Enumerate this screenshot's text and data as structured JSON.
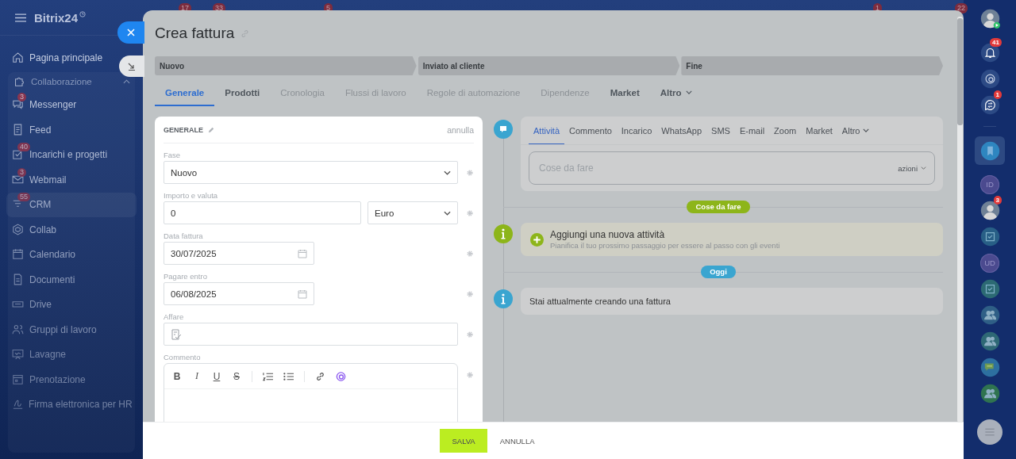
{
  "top_badges": [
    "17",
    "33",
    "5",
    "1",
    "22"
  ],
  "sidebar": {
    "brand": "Bitrix24",
    "items": [
      {
        "label": "Pagina principale",
        "selected": false
      },
      {
        "label": "Collaborazione",
        "expanded": true,
        "children": [
          {
            "label": "Messenger",
            "badge": "3",
            "selected": false
          },
          {
            "label": "Feed",
            "selected": false
          },
          {
            "label": "Incarichi e progetti",
            "badge": "40",
            "selected": false
          },
          {
            "label": "Webmail",
            "badge": "3",
            "selected": false
          },
          {
            "label": "CRM",
            "badge": "55",
            "selected": true
          },
          {
            "label": "Collab",
            "selected": false
          },
          {
            "label": "Calendario",
            "selected": false
          },
          {
            "label": "Documenti",
            "selected": false
          },
          {
            "label": "Drive",
            "selected": false
          },
          {
            "label": "Gruppi di lavoro",
            "selected": false
          },
          {
            "label": "Lavagne",
            "selected": false
          },
          {
            "label": "Prenotazione",
            "selected": false
          },
          {
            "label": "Firma elettronica per HR",
            "selected": false
          }
        ]
      }
    ]
  },
  "panel": {
    "title": "Crea fattura",
    "stages": [
      {
        "label": "Nuovo"
      },
      {
        "label": "Inviato al cliente"
      },
      {
        "label": "Fine"
      }
    ],
    "tabs": [
      {
        "label": "Generale",
        "selected": true,
        "disabled": false
      },
      {
        "label": "Prodotti",
        "selected": false,
        "disabled": false
      },
      {
        "label": "Cronologia",
        "selected": false,
        "disabled": true
      },
      {
        "label": "Flussi di lavoro",
        "selected": false,
        "disabled": true
      },
      {
        "label": "Regole di automazione",
        "selected": false,
        "disabled": true
      },
      {
        "label": "Dipendenze",
        "selected": false,
        "disabled": true
      },
      {
        "label": "Market",
        "selected": false,
        "disabled": false
      },
      {
        "label": "Altro",
        "selected": false,
        "disabled": false,
        "menu": true
      }
    ],
    "card": {
      "title": "GENERALE",
      "cancel": "annulla",
      "fields": [
        {
          "kind": "select",
          "label": "Fase",
          "value": "Nuovo"
        },
        {
          "kind": "money",
          "label": "Importo e valuta",
          "value": "0",
          "currency": "Euro"
        },
        {
          "kind": "date",
          "label": "Data fattura",
          "value": "30/07/2025"
        },
        {
          "kind": "date",
          "label": "Pagare entro",
          "value": "06/08/2025"
        },
        {
          "kind": "entity",
          "label": "Affare"
        },
        {
          "kind": "editor",
          "label": "Commento",
          "toolbar": [
            {
              "kind": "bold",
              "label": "B"
            },
            {
              "kind": "italic",
              "label": "I"
            },
            {
              "kind": "underline",
              "label": "U"
            },
            {
              "kind": "strike",
              "label": "S"
            },
            {
              "kind": "sep"
            },
            {
              "kind": "ordered"
            },
            {
              "kind": "bullets"
            },
            {
              "kind": "sep"
            },
            {
              "kind": "link"
            },
            {
              "kind": "copilot"
            }
          ]
        }
      ]
    },
    "timeline": {
      "tabs": [
        {
          "label": "Attività",
          "selected": true
        },
        {
          "label": "Commento",
          "selected": false
        },
        {
          "label": "Incarico",
          "selected": false
        },
        {
          "label": "WhatsApp",
          "selected": false
        },
        {
          "label": "SMS",
          "selected": false
        },
        {
          "label": "E-mail",
          "selected": false
        },
        {
          "label": "Zoom",
          "selected": false
        },
        {
          "label": "Market",
          "selected": false
        },
        {
          "label": "Altro",
          "selected": false,
          "menu": true
        }
      ],
      "todo_placeholder": "Cose da fare",
      "actions": "azioni",
      "sections": [
        {
          "pill": "Cose da fare",
          "color": "#8db51a",
          "items": [
            {
              "kind": "add",
              "title": "Aggiungi una nuova attività",
              "subtitle": "Pianifica il tuo prossimo passaggio per essere al passo con gli eventi"
            }
          ]
        },
        {
          "pill": "Oggi",
          "color": "#3aa5d0",
          "items": [
            {
              "kind": "info",
              "title": "Stai attualmente creando una fattura"
            }
          ]
        }
      ]
    },
    "footer": {
      "save": "SALVA",
      "cancel": "ANNULLA"
    }
  },
  "right_bar": [
    {
      "kind": "user",
      "selected": false
    },
    {
      "kind": "bell",
      "badge": "41",
      "selected": false
    },
    {
      "kind": "spiral",
      "selected": false
    },
    {
      "kind": "chat",
      "badge": "1",
      "selected": false
    },
    {
      "kind": "divider"
    },
    {
      "kind": "bookmark",
      "selected": true,
      "color": "#2e86c0"
    },
    {
      "kind": "initials",
      "text": "ID",
      "selected": false,
      "color": "#4b4a8f"
    },
    {
      "kind": "avatar",
      "badge": "3",
      "selected": false
    },
    {
      "kind": "task",
      "selected": false,
      "color": "#285f86"
    },
    {
      "kind": "initials",
      "text": "UD",
      "selected": false,
      "color": "#4b4a8f"
    },
    {
      "kind": "task",
      "selected": false,
      "color": "#2c6a73"
    },
    {
      "kind": "group",
      "selected": false,
      "color": "#2f5f86"
    },
    {
      "kind": "group",
      "selected": false,
      "color": "#2e6875"
    },
    {
      "kind": "messages",
      "selected": false,
      "color": "#2d6fa0"
    },
    {
      "kind": "group",
      "selected": false,
      "color": "#2f7350"
    },
    {
      "kind": "menu",
      "selected": false
    }
  ]
}
